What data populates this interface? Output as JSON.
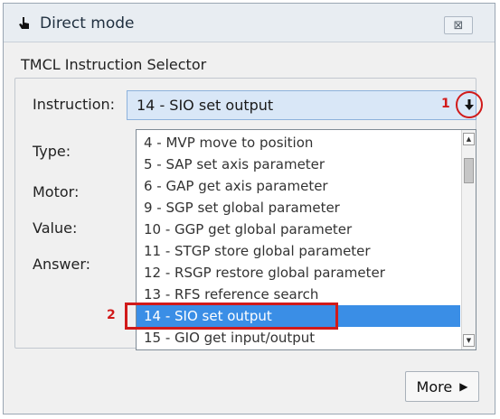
{
  "window": {
    "title": "Direct mode",
    "close_glyph": "⊠",
    "icon": "pointing-hand-icon"
  },
  "group": {
    "title": "TMCL Instruction Selector",
    "labels": {
      "instruction": "Instruction:",
      "type": "Type:",
      "motor": "Motor:",
      "value": "Value:",
      "answer": "Answer:"
    }
  },
  "instruction_combo": {
    "value": "14 - SIO set output",
    "arrow_icon": "down-arrow-icon"
  },
  "annotations": {
    "marker_1": "1",
    "marker_2": "2",
    "color": "#d11a1a"
  },
  "dropdown": {
    "items": [
      "4 - MVP move to position",
      "5 - SAP set axis parameter",
      "6 - GAP get axis parameter",
      "9 - SGP set global parameter",
      "10 - GGP get global parameter",
      "11 - STGP store global parameter",
      "12 - RSGP restore global parameter",
      "13 - RFS reference search",
      "14 - SIO set output",
      "15 - GIO get input/output"
    ],
    "selected_index": 8,
    "selection_color": "#3a8ee6"
  },
  "buttons": {
    "more_label": "More",
    "more_arrow": "▶"
  }
}
